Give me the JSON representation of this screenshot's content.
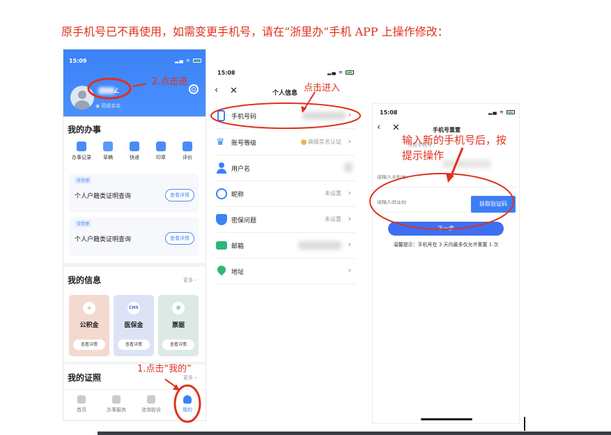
{
  "instruction": "原手机号已不再使用，如需变更手机号，请在“浙里办”手机 APP 上操作修改：",
  "phone1": {
    "time": "15:09",
    "realname_badge": "高级实名",
    "my_services_title": "我的办事",
    "services": [
      "办事记录",
      "草稿",
      "快递",
      "印章",
      "评价"
    ],
    "todos": [
      {
        "tag": "待受理",
        "text": "个人户籍类证明查询",
        "button": "查看详情"
      },
      {
        "tag": "待受理",
        "text": "个人户籍类证明查询",
        "button": "查看详情"
      }
    ],
    "my_info_title": "我的信息",
    "more": "更多",
    "info_cards": [
      {
        "icon": "home-icon",
        "glyph": "⌂",
        "label": "公积金",
        "button": "查看详情",
        "bg": "#f3d9cf",
        "fg": "#c77b5a"
      },
      {
        "icon": "chs-icon",
        "glyph": "CHS",
        "label": "医保金",
        "button": "查看详情",
        "bg": "#dde3f5",
        "fg": "#3b66d6"
      },
      {
        "icon": "ticket-icon",
        "glyph": "@",
        "label": "票据",
        "button": "查看详情",
        "bg": "#dde9e4",
        "fg": "#3f9c84"
      }
    ],
    "my_cert_title": "我的证照",
    "tabs": [
      "首页",
      "办事服务",
      "咨询投诉",
      "我的"
    ]
  },
  "phone2": {
    "time": "15:08",
    "title": "个人信息",
    "rows": [
      {
        "label": "手机号码",
        "value": "",
        "icon": "phone-icon",
        "color": "#3b82f6"
      },
      {
        "label": "账号等级",
        "value": "高级实名认证",
        "icon": "crown-icon",
        "color": "#3b82f6"
      },
      {
        "label": "用户名",
        "value": "",
        "icon": "user-icon",
        "color": "#3b82f6"
      },
      {
        "label": "昵称",
        "value": "未设置",
        "icon": "nickname-icon",
        "color": "#3b82f6"
      },
      {
        "label": "密保问题",
        "value": "未设置",
        "icon": "shield-icon",
        "color": "#3b82f6"
      },
      {
        "label": "邮箱",
        "value": "",
        "icon": "mail-icon",
        "color": "#2fb67a"
      },
      {
        "label": "地址",
        "value": "",
        "icon": "location-icon",
        "color": "#2fb67a"
      }
    ]
  },
  "phone3": {
    "time": "15:08",
    "title": "手机号重置",
    "current_phone_label": "当前手机号：",
    "phone_placeholder": "请输入手机号",
    "code_placeholder": "请输入验证码",
    "sms_button": "获取验证码",
    "next_button": "下一步",
    "hint": "温馨提示：手机号在 3 天内最多仅允许重置 1 次"
  },
  "annotations": {
    "step1": "1.点击“我的”",
    "step2": "2.点击进",
    "step3": "点击进入",
    "step4_line1": "输入新的手机号后，按",
    "step4_line2": "提示操作",
    "color": "#e0301e"
  }
}
